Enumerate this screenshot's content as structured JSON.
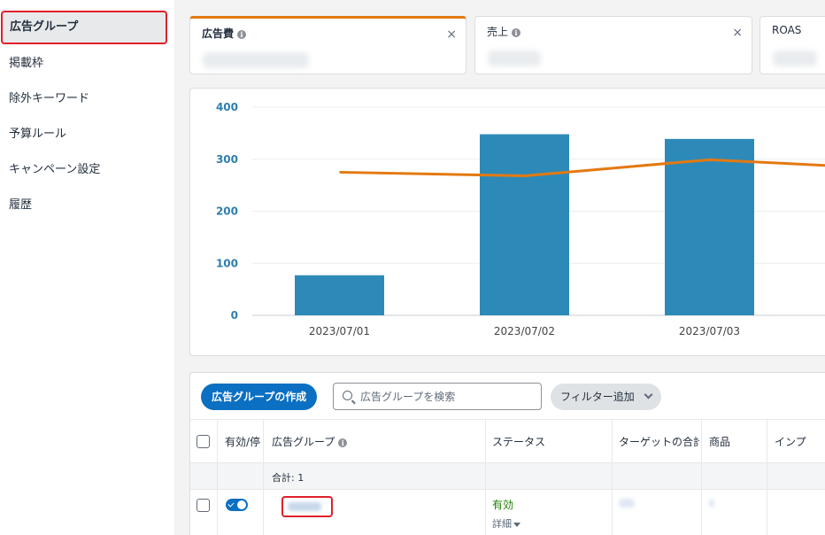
{
  "sidebar": {
    "items": [
      {
        "label": "広告グループ",
        "active": true
      },
      {
        "label": "掲載枠"
      },
      {
        "label": "除外キーワード"
      },
      {
        "label": "予算ルール"
      },
      {
        "label": "キャンペーン設定"
      },
      {
        "label": "履歴"
      }
    ]
  },
  "metrics": [
    {
      "label": "広告費",
      "info_icon": "info-icon",
      "close": "×",
      "selected": true
    },
    {
      "label": "売上",
      "info_icon": "info-icon",
      "close": "×"
    },
    {
      "label": "ROAS"
    }
  ],
  "chart_data": {
    "type": "bar",
    "categories": [
      "2023/07/01",
      "2023/07/02",
      "2023/07/03"
    ],
    "series": [
      {
        "values": [
          77,
          348,
          339
        ],
        "kind": "bar",
        "color": "#2d8ab8"
      },
      {
        "values": [
          275,
          268,
          299
        ],
        "kind": "line",
        "color": "#e47911",
        "continues_right": 287
      }
    ],
    "ylim": [
      0,
      400
    ],
    "yticks": [
      "0",
      "100",
      "200",
      "300",
      "400"
    ],
    "grid": true
  },
  "toolbar": {
    "create_label": "広告グループの作成",
    "search_placeholder": "広告グループを検索",
    "filter_label": "フィルター追加"
  },
  "table": {
    "columns": [
      "有効/停",
      "広告グループ",
      "ステータス",
      "ターゲットの合計",
      "商品",
      "インプ"
    ],
    "name_info_icon": "info-icon",
    "summary": "合計: 1",
    "rows": [
      {
        "enabled": true,
        "status": "有効",
        "detail": "詳細"
      }
    ]
  },
  "colors": {
    "accent": "#0b6fc2",
    "bar": "#2d8ab8",
    "line": "#e47911",
    "active_outline": "#e0202a",
    "status_ok": "#1d8102"
  }
}
